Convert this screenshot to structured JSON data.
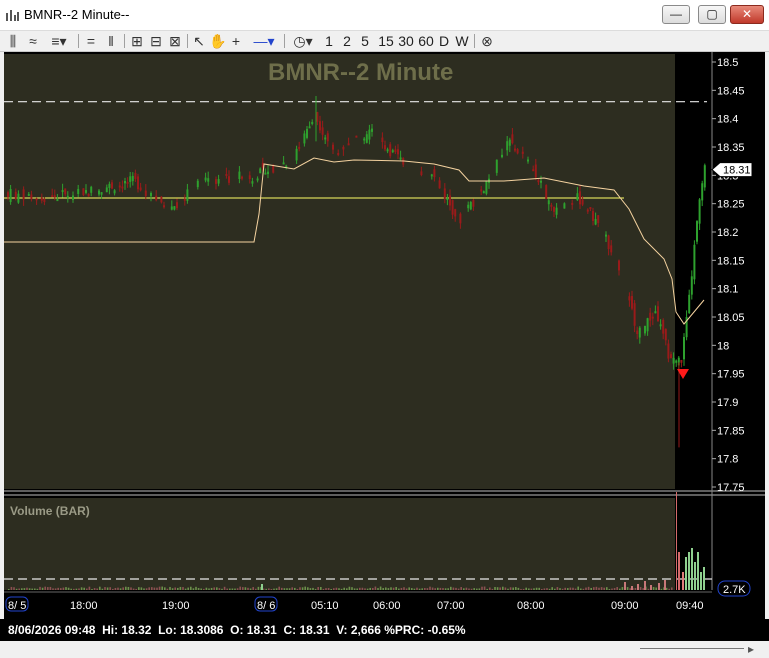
{
  "window": {
    "title": "BMNR--2 Minute--",
    "icon": "bar-chart-icon",
    "minimize_label": "—",
    "maximize_label": "▢",
    "close_label": "✕"
  },
  "toolbar": {
    "periods": [
      "1",
      "2",
      "5",
      "15",
      "30",
      "60",
      "D",
      "W"
    ],
    "icons": [
      "bar-style-icon",
      "line-style-icon",
      "drawing-tools-icon",
      "horizontal-line-icon",
      "vertical-line-icon",
      "zoom-in-icon",
      "zoom-out-icon",
      "zoom-fit-icon",
      "pointer-icon",
      "pan-hand-icon",
      "crosshair-icon",
      "line-color-icon",
      "clock-icon",
      "cancel-icon"
    ]
  },
  "chart": {
    "title": "BMNR--2 Minute",
    "price_ticks": [
      "18.5",
      "18.45",
      "18.4",
      "18.35",
      "18.3",
      "18.25",
      "18.2",
      "18.15",
      "18.1",
      "18.05",
      "18",
      "17.95",
      "17.9",
      "17.85",
      "17.8",
      "17.75"
    ],
    "last_price_label": "18.31",
    "volume_label": "Volume (BAR)",
    "volume_last_label": "2.7K",
    "time_labels": [
      "8/ 5",
      "18:00",
      "19:00",
      "8/ 6",
      "05:10",
      "06:00",
      "07:00",
      "08:00",
      "09:00",
      "09:40"
    ],
    "colors": {
      "background": "#2d2d20",
      "premarket_bg": "#000000",
      "up": "#2ea12e",
      "down": "#9a1a1a",
      "vwap": "#f5d3a0",
      "open_line": "#ffff66",
      "dashed": "#e8e8e8",
      "signal": "#ff1a1a"
    }
  },
  "chart_data": {
    "type": "candlestick",
    "title": "BMNR--2 Minute",
    "y_range": [
      17.75,
      18.5
    ],
    "horizontal_lines": {
      "dashed_resistance": 18.43,
      "yellow_open_line": 18.26
    },
    "last_price": 18.31,
    "session_low": 17.82,
    "session_high": 18.44,
    "volume_last": "2.7K",
    "x_ticks": [
      "8/ 5",
      "18:00",
      "19:00",
      "8/ 6",
      "05:10",
      "06:00",
      "07:00",
      "08:00",
      "09:00",
      "09:40"
    ]
  },
  "status": {
    "text": "8/06/2026 09:48  Hi: 18.32  Lo: 18.3086  O: 18.31  C: 18.31  V: 2,666 %PRC: -0.65%"
  }
}
